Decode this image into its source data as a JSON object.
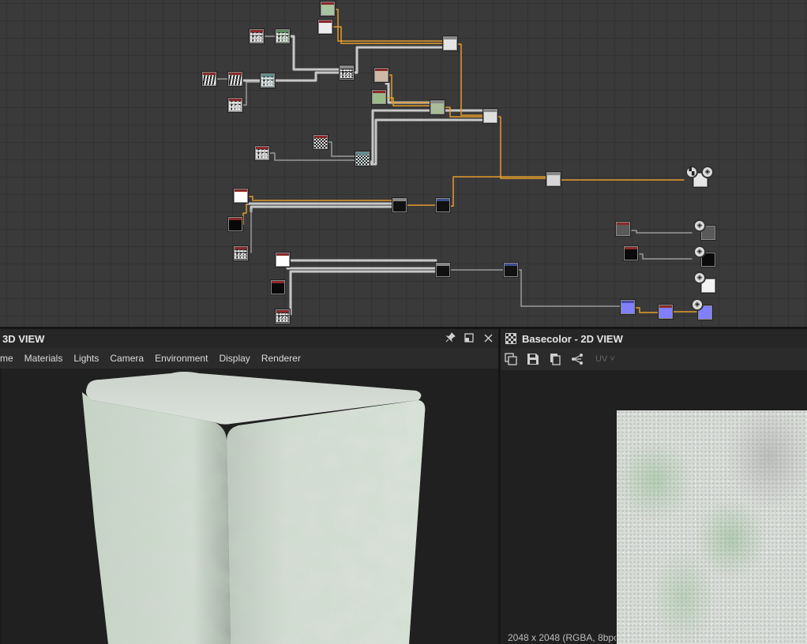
{
  "graph": {
    "nodes": [
      {
        "id": "n1",
        "style": "solid",
        "fill": "#a9c4a0",
        "header": "#8b2a2a"
      },
      {
        "id": "n2",
        "style": "solid",
        "fill": "#ececec",
        "header": "#8b2a2a"
      },
      {
        "id": "n3",
        "style": "noise",
        "fill": "#888888",
        "header": "#8b2a2a"
      },
      {
        "id": "n4",
        "style": "noise",
        "fill": "#6c8c6c",
        "header": "#5c8c5c"
      },
      {
        "id": "n5",
        "style": "stripes",
        "fill": "#cccccc",
        "header": "#8b2a2a"
      },
      {
        "id": "n6",
        "style": "stripes",
        "fill": "#a0a090",
        "header": "#8b2a2a"
      },
      {
        "id": "n7",
        "style": "noise",
        "fill": "#8fa8a8",
        "header": "#5c8c8c"
      },
      {
        "id": "n8",
        "style": "noise",
        "fill": "#aaaaaa",
        "header": "#8b2a2a"
      },
      {
        "id": "n9",
        "style": "noise",
        "fill": "#222222",
        "header": "#888888"
      },
      {
        "id": "n10",
        "style": "solid",
        "fill": "#e4e4e4",
        "header": "#888888"
      },
      {
        "id": "n11",
        "style": "solid",
        "fill": "#cdb9a6",
        "header": "#8b2a2a"
      },
      {
        "id": "n12",
        "style": "solid",
        "fill": "#9cb98a",
        "header": "#8b2a2a"
      },
      {
        "id": "n13",
        "style": "solid",
        "fill": "#a8bc98",
        "header": "#888888"
      },
      {
        "id": "n14",
        "style": "solid",
        "fill": "#e0e0e0",
        "header": "#888888"
      },
      {
        "id": "n15",
        "style": "checker",
        "fill": "#dddddd",
        "header": "#8b2a2a"
      },
      {
        "id": "n16",
        "style": "noise",
        "fill": "#999999",
        "header": "#8b2a2a"
      },
      {
        "id": "n17",
        "style": "checker",
        "fill": "#d8e6e6",
        "header": "#5c8c8c"
      },
      {
        "id": "n18",
        "style": "solid",
        "fill": "#d6d6d6",
        "header": "#888888"
      },
      {
        "id": "n19",
        "style": "solid",
        "fill": "#ffffff",
        "header": "#8b2a2a"
      },
      {
        "id": "n20",
        "style": "solid",
        "fill": "#080808",
        "header": "#8b2a2a"
      },
      {
        "id": "n21",
        "style": "noise",
        "fill": "#444444",
        "header": "#8b2a2a"
      },
      {
        "id": "n22",
        "style": "solid",
        "fill": "#111111",
        "header": "#888888"
      },
      {
        "id": "n23",
        "style": "solid",
        "fill": "#111111",
        "header": "#3d4c8c"
      },
      {
        "id": "n24",
        "style": "solid",
        "fill": "#ffffff",
        "header": "#8b2a2a"
      },
      {
        "id": "n25",
        "style": "solid",
        "fill": "#080808",
        "header": "#8b2a2a"
      },
      {
        "id": "n26",
        "style": "noise",
        "fill": "#444444",
        "header": "#8b2a2a"
      },
      {
        "id": "n27",
        "style": "solid",
        "fill": "#111111",
        "header": "#888888"
      },
      {
        "id": "n28",
        "style": "solid",
        "fill": "#111111",
        "header": "#3d4c8c"
      },
      {
        "id": "n29",
        "style": "solid",
        "fill": "#8080ff",
        "header": "#4a4aaa"
      },
      {
        "id": "n30",
        "style": "solid",
        "fill": "#8080ff",
        "header": "#8b2a2a"
      },
      {
        "id": "n31",
        "style": "solid",
        "fill": "#5a5a5a",
        "header": "#8b2a2a"
      },
      {
        "id": "n32",
        "style": "solid",
        "fill": "#0a0a0a",
        "header": "#8b2a2a"
      }
    ],
    "outputs": [
      {
        "id": "o1",
        "fill": "#e6e6e6"
      },
      {
        "id": "o2",
        "fill": "#5a5a5a"
      },
      {
        "id": "o3",
        "fill": "#0a0a0a"
      },
      {
        "id": "o4",
        "fill": "#f2f2f2"
      },
      {
        "id": "o5",
        "fill": "#8080ff"
      }
    ],
    "wire_colors": {
      "white": "#c8c8c8",
      "orange": "#e39b2c",
      "gray": "#a0a0a0"
    }
  },
  "view3d": {
    "title": "3D VIEW",
    "menus": [
      "me",
      "Materials",
      "Lights",
      "Camera",
      "Environment",
      "Display",
      "Renderer"
    ],
    "pin_icon": "pin-icon",
    "float_icon": "float-window-icon",
    "close_icon": "close-icon"
  },
  "view2d": {
    "title": "Basecolor - 2D VIEW",
    "uv_label": "UV",
    "resolution_text": "2048 x 2048 (RGBA, 8bpc)"
  },
  "colors": {
    "graph_bg": "#3a3a3a",
    "panel_bg": "#262626",
    "toolbar_bg": "#2b2b2b",
    "accent_orange": "#e39b2c"
  }
}
